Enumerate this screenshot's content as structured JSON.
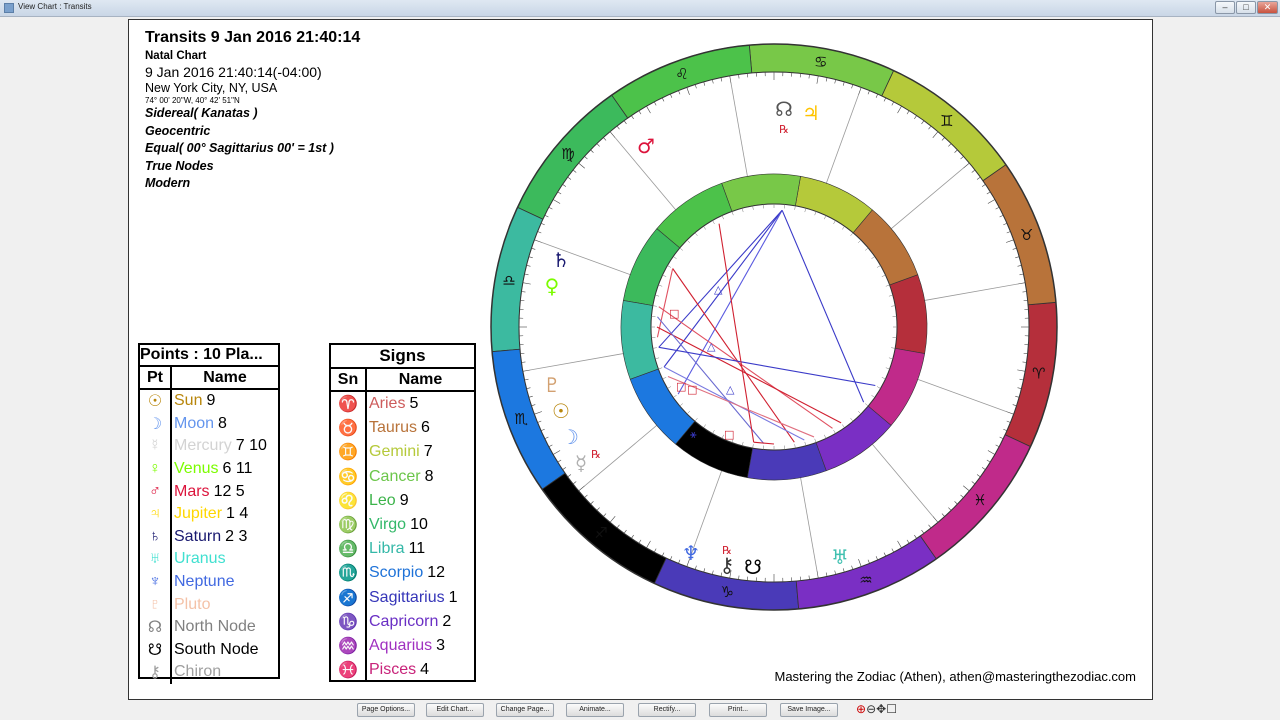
{
  "window": {
    "title": "View Chart : Transits"
  },
  "header": {
    "title": "Transits 9 Jan 2016 21:40:14",
    "subtitle": "Natal Chart",
    "datetime": "9 Jan 2016 21:40:14(-04:00)",
    "location": "New York City, NY, USA",
    "coords": "74° 00' 20\"W, 40° 42' 51\"N",
    "settings": [
      "Sidereal( Kanatas )",
      "Geocentric",
      "Equal( 00° Sagittarius 00' = 1st )",
      "True Nodes",
      "Modern"
    ]
  },
  "points_table": {
    "title": "Points : 10 Pla...",
    "col_pt": "Pt",
    "col_name": "Name",
    "rows": [
      {
        "glyph": "☉",
        "name": "Sun",
        "nums": "9",
        "color": "#b8860b"
      },
      {
        "glyph": "☽",
        "name": "Moon",
        "nums": "8",
        "color": "#6495ed"
      },
      {
        "glyph": "☿",
        "name": "Mercury",
        "nums": "7 10",
        "color": "#d3d3d3"
      },
      {
        "glyph": "♀",
        "name": "Venus",
        "nums": "6 11",
        "color": "#7cfc00"
      },
      {
        "glyph": "♂",
        "name": "Mars",
        "nums": "12 5",
        "color": "#dc143c"
      },
      {
        "glyph": "♃",
        "name": "Jupiter",
        "nums": "1 4",
        "color": "#ffd700"
      },
      {
        "glyph": "♄",
        "name": "Saturn",
        "nums": "2 3",
        "color": "#191970"
      },
      {
        "glyph": "♅",
        "name": "Uranus",
        "nums": "",
        "color": "#40e0d0"
      },
      {
        "glyph": "♆",
        "name": "Neptune",
        "nums": "",
        "color": "#4169e1"
      },
      {
        "glyph": "♇",
        "name": "Pluto",
        "nums": "",
        "color": "#f4c2a8"
      },
      {
        "glyph": "☊",
        "name": "North Node",
        "nums": "",
        "color": "#808080"
      },
      {
        "glyph": "☋",
        "name": "South Node",
        "nums": "",
        "color": "#000000"
      },
      {
        "glyph": "⚷",
        "name": "Chiron",
        "nums": "",
        "color": "#a0a0a0"
      }
    ]
  },
  "signs_table": {
    "title": "Signs",
    "col_sn": "Sn",
    "col_name": "Name",
    "rows": [
      {
        "glyph": "♈",
        "name": "Aries",
        "num": "5",
        "color": "#cd5c5c"
      },
      {
        "glyph": "♉",
        "name": "Taurus",
        "num": "6",
        "color": "#b8733a"
      },
      {
        "glyph": "♊",
        "name": "Gemini",
        "num": "7",
        "color": "#b5c93a"
      },
      {
        "glyph": "♋",
        "name": "Cancer",
        "num": "8",
        "color": "#6cc64a"
      },
      {
        "glyph": "♌",
        "name": "Leo",
        "num": "9",
        "color": "#3cb34a"
      },
      {
        "glyph": "♍",
        "name": "Virgo",
        "num": "10",
        "color": "#33b869"
      },
      {
        "glyph": "♎",
        "name": "Libra",
        "num": "11",
        "color": "#35b8a8"
      },
      {
        "glyph": "♏",
        "name": "Scorpio",
        "num": "12",
        "color": "#1e72d8"
      },
      {
        "glyph": "♐",
        "name": "Sagittarius",
        "num": "1",
        "color": "#3535b8"
      },
      {
        "glyph": "♑",
        "name": "Capricorn",
        "num": "2",
        "color": "#6a2fc4"
      },
      {
        "glyph": "♒",
        "name": "Aquarius",
        "num": "3",
        "color": "#a030c0"
      },
      {
        "glyph": "♓",
        "name": "Pisces",
        "num": "4",
        "color": "#c8237a"
      }
    ]
  },
  "credit": "Mastering the Zodiac (Athen), athen@masteringthezodiac.com",
  "chart": {
    "outer_signs": [
      {
        "name": "Aries",
        "glyph": "♈",
        "color": "#b52f3b"
      },
      {
        "name": "Taurus",
        "glyph": "♉",
        "color": "#b8733a"
      },
      {
        "name": "Gemini",
        "glyph": "♊",
        "color": "#b5c93a"
      },
      {
        "name": "Cancer",
        "glyph": "♋",
        "color": "#78c848"
      },
      {
        "name": "Leo",
        "glyph": "♌",
        "color": "#4cc24a"
      },
      {
        "name": "Virgo",
        "glyph": "♍",
        "color": "#3cba5c"
      },
      {
        "name": "Libra",
        "glyph": "♎",
        "color": "#3cbaa0"
      },
      {
        "name": "Scorpio",
        "glyph": "♏",
        "color": "#1c78e0"
      },
      {
        "name": "Sagittarius",
        "glyph": "♐",
        "color": "#000000"
      },
      {
        "name": "Capricorn",
        "glyph": "♑",
        "color": "#4a3ab8"
      },
      {
        "name": "Aquarius",
        "glyph": "♒",
        "color": "#7a2fc4"
      },
      {
        "name": "Pisces",
        "glyph": "♓",
        "color": "#c02a8a"
      }
    ],
    "outer_planets": [
      {
        "glyph": "☊",
        "color": "#555555",
        "retro": true
      },
      {
        "glyph": "♃",
        "color": "#ffc400",
        "retro": false
      },
      {
        "glyph": "♂",
        "color": "#dc143c",
        "retro": false
      },
      {
        "glyph": "♄",
        "color": "#191970",
        "retro": false
      },
      {
        "glyph": "♀",
        "color": "#7cfc00",
        "retro": false
      },
      {
        "glyph": "♇",
        "color": "#d2a070",
        "retro": false
      },
      {
        "glyph": "☉",
        "color": "#b8860b",
        "retro": false
      },
      {
        "glyph": "☽",
        "color": "#6495ed",
        "retro": false
      },
      {
        "glyph": "☿",
        "color": "#b0b0b0",
        "retro": true
      },
      {
        "glyph": "♆",
        "color": "#4169e1",
        "retro": false
      },
      {
        "glyph": "⚷",
        "color": "#333333",
        "retro": true
      },
      {
        "glyph": "☋",
        "color": "#000000",
        "retro": false
      },
      {
        "glyph": "♅",
        "color": "#40c0b0",
        "retro": false
      }
    ],
    "retro_symbol": "℞"
  },
  "toolbar": {
    "buttons": [
      "Page Options...",
      "Edit Chart...",
      "Change Page...",
      "Animate...",
      "Rectify...",
      "Print...",
      "Save Image..."
    ]
  }
}
